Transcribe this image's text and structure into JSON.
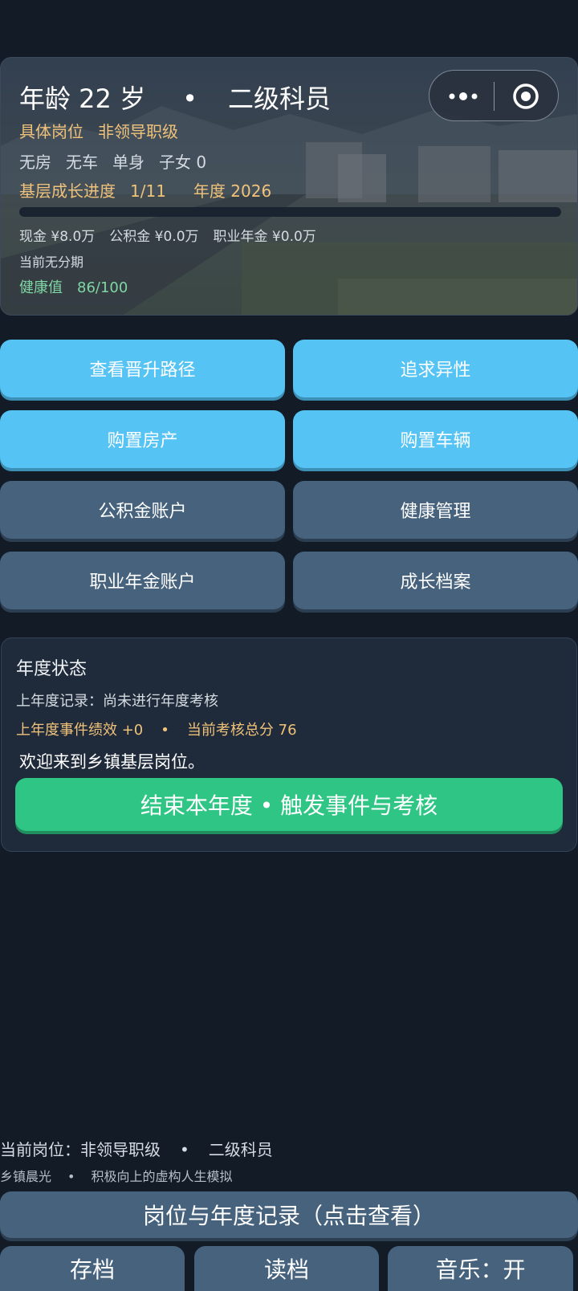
{
  "header": {
    "title_age": "年龄 22 岁",
    "title_dot": "•",
    "title_rank": "二级科员",
    "position_label": "具体岗位",
    "position_value": "非领导职级",
    "house": "无房",
    "car": "无车",
    "marital": "单身",
    "children": "子女 0",
    "progress_label": "基层成长进度",
    "progress_value": "1/11",
    "progress_fraction": 0.0,
    "year_label": "年度 2026",
    "cash": "现金 ¥8.0万",
    "housing_fund": "公积金 ¥0.0万",
    "annuity": "职业年金 ¥0.0万",
    "installment": "当前无分期",
    "health_label": "健康值",
    "health_value": "86/100"
  },
  "capsule": {
    "more_icon": "more-dots-icon",
    "close_icon": "target-close-icon"
  },
  "actions": {
    "promotion_path": "查看晋升路径",
    "pursue_partner": "追求异性",
    "buy_house": "购置房产",
    "buy_car": "购置车辆",
    "housing_fund_account": "公积金账户",
    "health_management": "健康管理",
    "annuity_account": "职业年金账户",
    "growth_archive": "成长档案"
  },
  "status": {
    "title": "年度状态",
    "last_record": "上年度记录：尚未进行年度考核",
    "event_perf": "上年度事件绩效 +0",
    "dot": "•",
    "total_score": "当前考核总分 76",
    "welcome": "欢迎来到乡镇基层岗位。",
    "end_year_button": "结束本年度 • 触发事件与考核"
  },
  "footer": {
    "current_position": "当前岗位：非领导职级",
    "dot": "•",
    "current_rank": "二级科员",
    "brand": "乡镇晨光",
    "slogan": "积极向上的虚构人生模拟",
    "record_button": "岗位与年度记录（点击查看）",
    "save_button": "存档",
    "load_button": "读档",
    "music_button": "音乐：开"
  },
  "colors": {
    "background": "#131b26",
    "accent_blue": "#55c3f4",
    "slate_button": "#46627d",
    "green_button": "#2fc584",
    "gold_text": "#f0c27a",
    "health_green": "#7fd6a4"
  }
}
